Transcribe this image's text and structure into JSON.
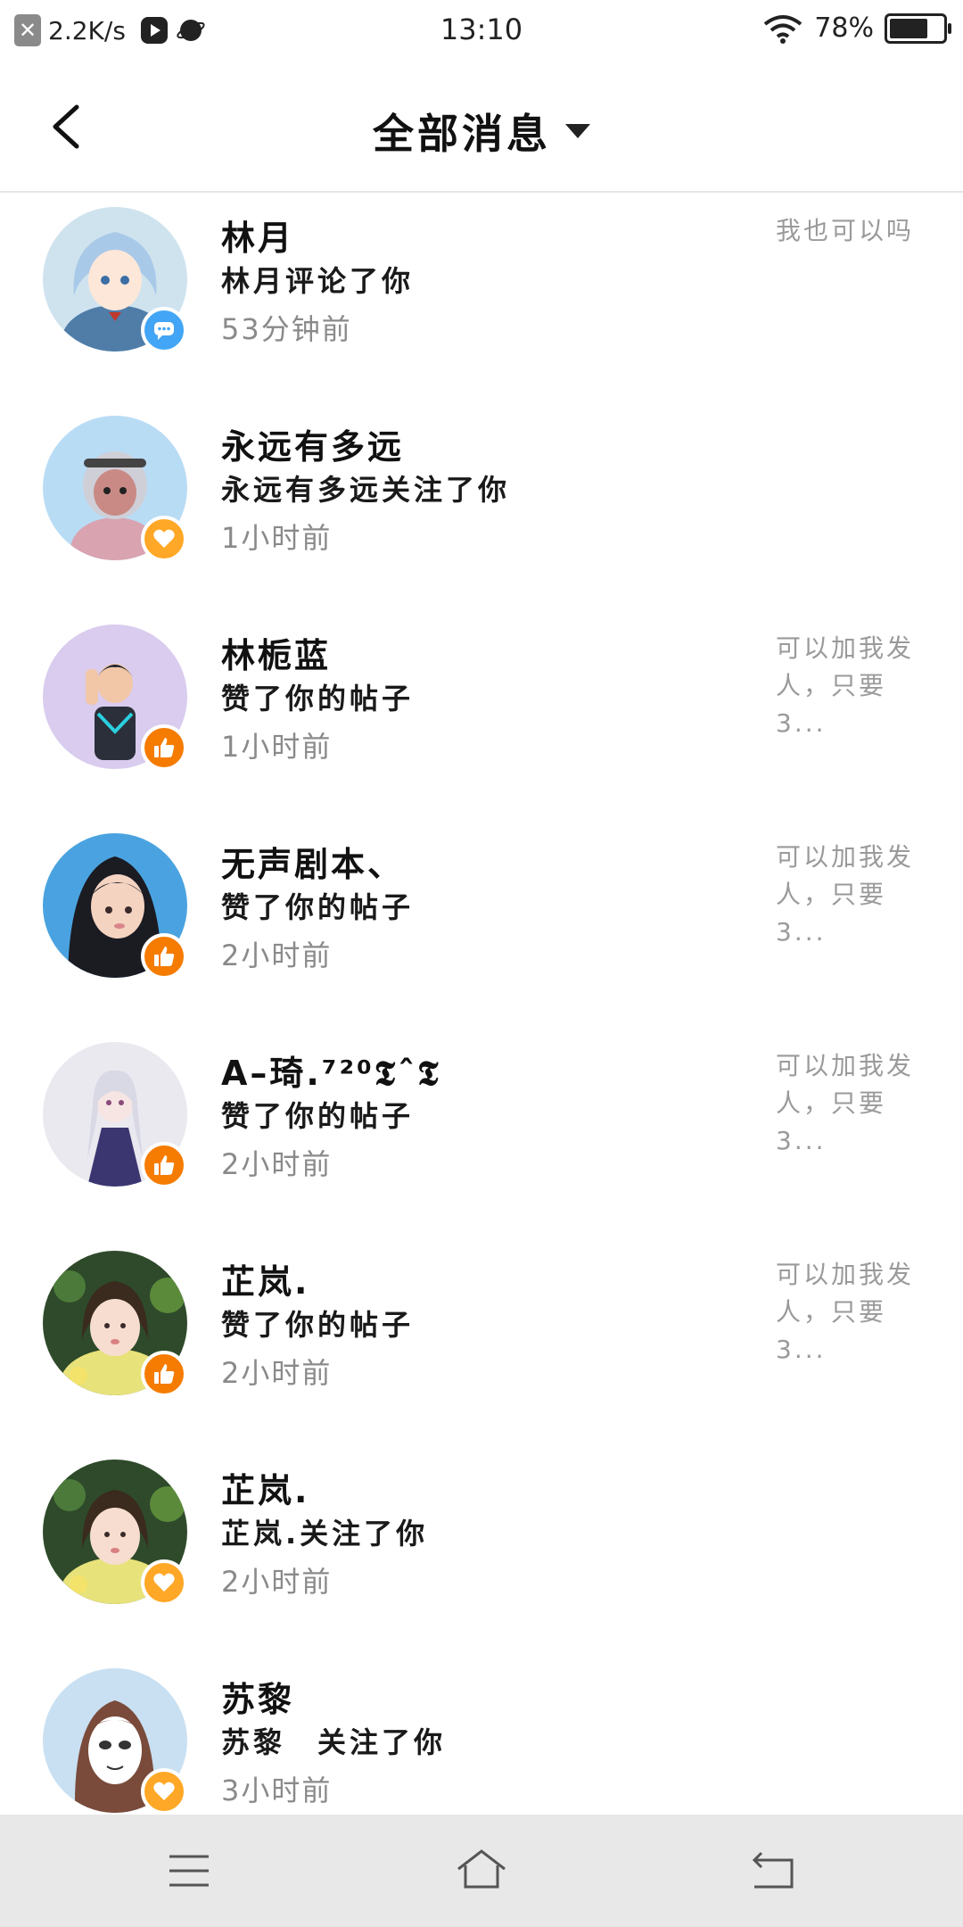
{
  "status_bar": {
    "speed": "2.2K/s",
    "time": "13:10",
    "battery_text": "78%",
    "battery_level": 0.78
  },
  "header": {
    "title": "全部消息"
  },
  "colors": {
    "comment_badge": "#42a5f5",
    "follow_badge": "#ffa726",
    "like_badge": "#f57c00",
    "preview_text": "#9a9a9a",
    "time_text": "#8a8a8a"
  },
  "messages": [
    {
      "name": "林月",
      "action": "林月评论了你",
      "time": "53分钟前",
      "preview": "我也可以吗",
      "badge_icon": "comment-icon"
    },
    {
      "name": "永远有多远",
      "action": "永远有多远关注了你",
      "time": "1小时前",
      "preview": "",
      "badge_icon": "heart-icon"
    },
    {
      "name": "林栀蓝",
      "action": "赞了你的帖子",
      "time": "1小时前",
      "preview": "可以加我发人，只要3...",
      "badge_icon": "thumbs-up-icon"
    },
    {
      "name": "无声剧本、",
      "action": "赞了你的帖子",
      "time": "2小时前",
      "preview": "可以加我发人，只要3...",
      "badge_icon": "thumbs-up-icon"
    },
    {
      "name": "A–琦.⁷²⁰𝕿ˆ𝕿",
      "action": "赞了你的帖子",
      "time": "2小时前",
      "preview": "可以加我发人，只要3...",
      "badge_icon": "thumbs-up-icon"
    },
    {
      "name": "芷岚.",
      "action": "赞了你的帖子",
      "time": "2小时前",
      "preview": "可以加我发人，只要3...",
      "badge_icon": "thumbs-up-icon"
    },
    {
      "name": "芷岚.",
      "action": "芷岚.关注了你",
      "time": "2小时前",
      "preview": "",
      "badge_icon": "heart-icon"
    },
    {
      "name": "苏黎",
      "action": "苏黎　关注了你",
      "time": "3小时前",
      "preview": "",
      "badge_icon": "heart-icon"
    }
  ],
  "nav": {
    "menu_icon": "menu-icon",
    "home_icon": "home-icon",
    "back_icon": "back-icon"
  }
}
